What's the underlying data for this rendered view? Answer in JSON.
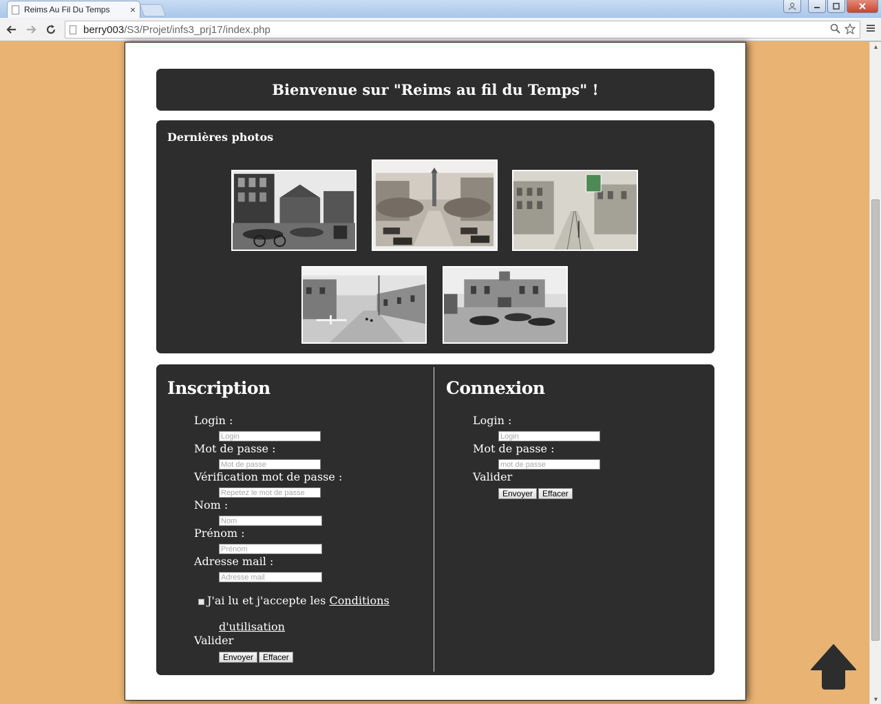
{
  "browser": {
    "tab_title": "Reims Au Fil Du Temps",
    "tab_close": "×",
    "url_host": "berry003",
    "url_path": "/S3/Projet/infs3_prj17/index.php"
  },
  "welcome": {
    "text": "Bienvenue sur \"Reims au fil du Temps\" !"
  },
  "photos": {
    "title": "Dernières photos",
    "items": [
      {
        "subject": "marketplace-photo"
      },
      {
        "subject": "boulevard-photo"
      },
      {
        "subject": "street-postcard"
      },
      {
        "subject": "village-street-photo"
      },
      {
        "subject": "town-hall-square-photo"
      }
    ]
  },
  "inscription": {
    "title": "Inscription",
    "login_label": "Login :",
    "login_placeholder": "Login",
    "password_label": "Mot de passe :",
    "password_placeholder": "Mot de passe",
    "verify_label": "Vérification mot de passe :",
    "verify_placeholder": "Repetez le mot de passe",
    "nom_label": "Nom :",
    "nom_placeholder": "Nom",
    "prenom_label": "Prénom :",
    "prenom_placeholder": "Prénom",
    "email_label": "Adresse mail :",
    "email_placeholder": "Adresse mail",
    "terms_text": "J'ai lu et j'accepte les",
    "terms_link_1": "Conditions",
    "terms_link_2": "d'utilisation",
    "valider_label": "Valider",
    "submit": "Envoyer",
    "reset": "Effacer"
  },
  "connexion": {
    "title": "Connexion",
    "login_label": "Login :",
    "login_placeholder": "Login",
    "password_label": "Mot de passe :",
    "password_placeholder": "mot de passe",
    "valider_label": "Valider",
    "submit": "Envoyer",
    "reset": "Effacer"
  },
  "colors": {
    "background": "#e8b373",
    "panel": "#2d2d2d",
    "page": "#ffffff"
  },
  "icons": [
    "back-icon",
    "forward-icon",
    "reload-icon",
    "search-icon",
    "star-icon",
    "menu-icon",
    "back-to-top-icon"
  ]
}
